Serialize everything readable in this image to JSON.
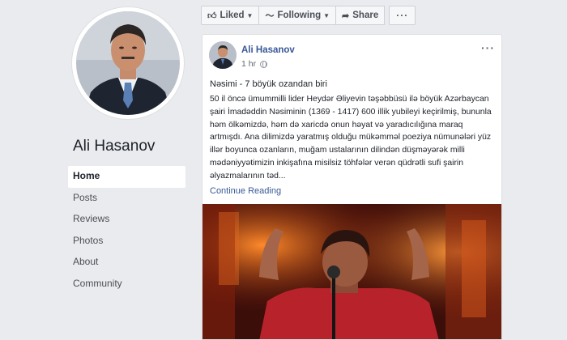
{
  "profile": {
    "name": "Ali Hasanov"
  },
  "nav": {
    "items": [
      {
        "label": "Home",
        "active": true
      },
      {
        "label": "Posts",
        "active": false
      },
      {
        "label": "Reviews",
        "active": false
      },
      {
        "label": "Photos",
        "active": false
      },
      {
        "label": "About",
        "active": false
      },
      {
        "label": "Community",
        "active": false
      }
    ]
  },
  "toolbar": {
    "liked_label": "Liked",
    "following_label": "Following",
    "share_label": "Share",
    "more_label": "···"
  },
  "post": {
    "author": "Ali Hasanov",
    "time": "1 hr",
    "options": "···",
    "title": "Nəsimi - 7 böyük ozandan biri",
    "body": "50 il öncə ümummilli lider Heydər Əliyevin təşəbbüsü ilə böyük Azərbaycan şairi İmadəddin Nəsiminin (1369 - 1417) 600 illik yubileyi keçirilmiş, bununla həm ölkəmizdə, həm də xaricdə onun həyat və yaradıcılığına maraq artmışdı. Ana dilimizdə yaratmış olduğu mükəmməl poeziya nümunələri yüz illər boyunca ozanların, muğam ustalarının dilindən düşməyərək milli mədəniyyətimizin inkişafına misilsiz töhfələr verən qüdrətli sufi şairin əlyazmalarının təd...",
    "continue_label": "Continue Reading"
  },
  "colors": {
    "link": "#385898",
    "background": "#e9ebee"
  }
}
